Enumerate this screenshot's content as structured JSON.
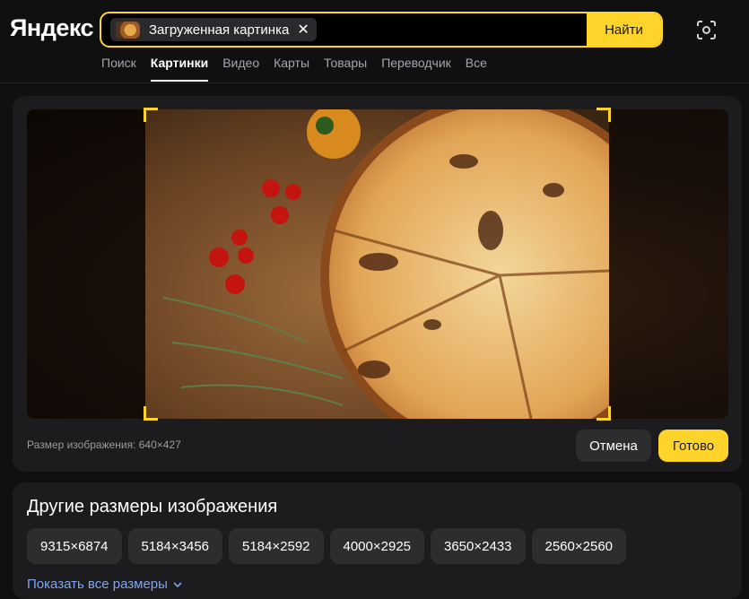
{
  "header": {
    "logo": "Яндекс",
    "search": {
      "chip_label": "Загруженная картинка",
      "close_glyph": "✕",
      "submit_label": "Найти"
    },
    "camera_icon": "camera-search-icon",
    "tabs": [
      {
        "label": "Поиск",
        "active": false
      },
      {
        "label": "Картинки",
        "active": true
      },
      {
        "label": "Видео",
        "active": false
      },
      {
        "label": "Карты",
        "active": false
      },
      {
        "label": "Товары",
        "active": false
      },
      {
        "label": "Переводчик",
        "active": false
      },
      {
        "label": "Все",
        "active": false
      }
    ]
  },
  "editor": {
    "size_text": "Размер изображения: 640×427",
    "cancel_label": "Отмена",
    "done_label": "Готово"
  },
  "sizes": {
    "title": "Другие размеры изображения",
    "items": [
      "9315×6874",
      "5184×3456",
      "5184×2592",
      "4000×2925",
      "3650×2433",
      "2560×2560"
    ],
    "show_all_label": "Показать все размеры"
  },
  "colors": {
    "accent": "#fed42b",
    "background": "#101011",
    "panel": "#1c1c1e",
    "link": "#7da5f0"
  }
}
